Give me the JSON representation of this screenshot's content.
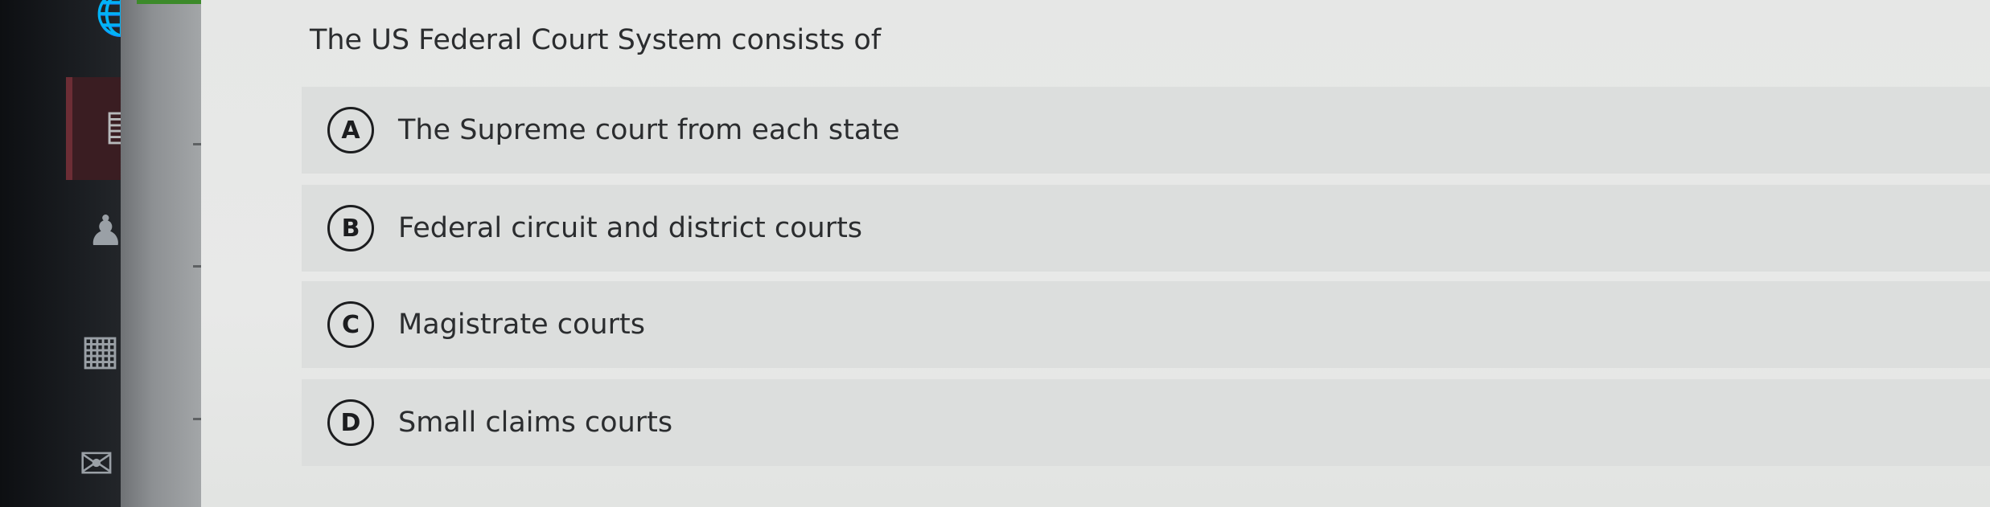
{
  "question": {
    "text": "The US Federal Court System consists of"
  },
  "options": [
    {
      "letter": "A",
      "text": "The Supreme court from each state"
    },
    {
      "letter": "B",
      "text": "Federal circuit and district courts"
    },
    {
      "letter": "C",
      "text": "Magistrate courts"
    },
    {
      "letter": "D",
      "text": "Small claims courts"
    }
  ],
  "sidebar": {
    "icons": [
      "globe-icon",
      "book-icon",
      "people-icon",
      "calendar-icon",
      "mail-icon"
    ],
    "active_item": "book-icon"
  },
  "colors": {
    "page_background": "#e6e7e6",
    "option_background": "#dcdedd",
    "text": "#2b2d2f",
    "rail": "#141618",
    "active_item": "#3a1d22"
  }
}
